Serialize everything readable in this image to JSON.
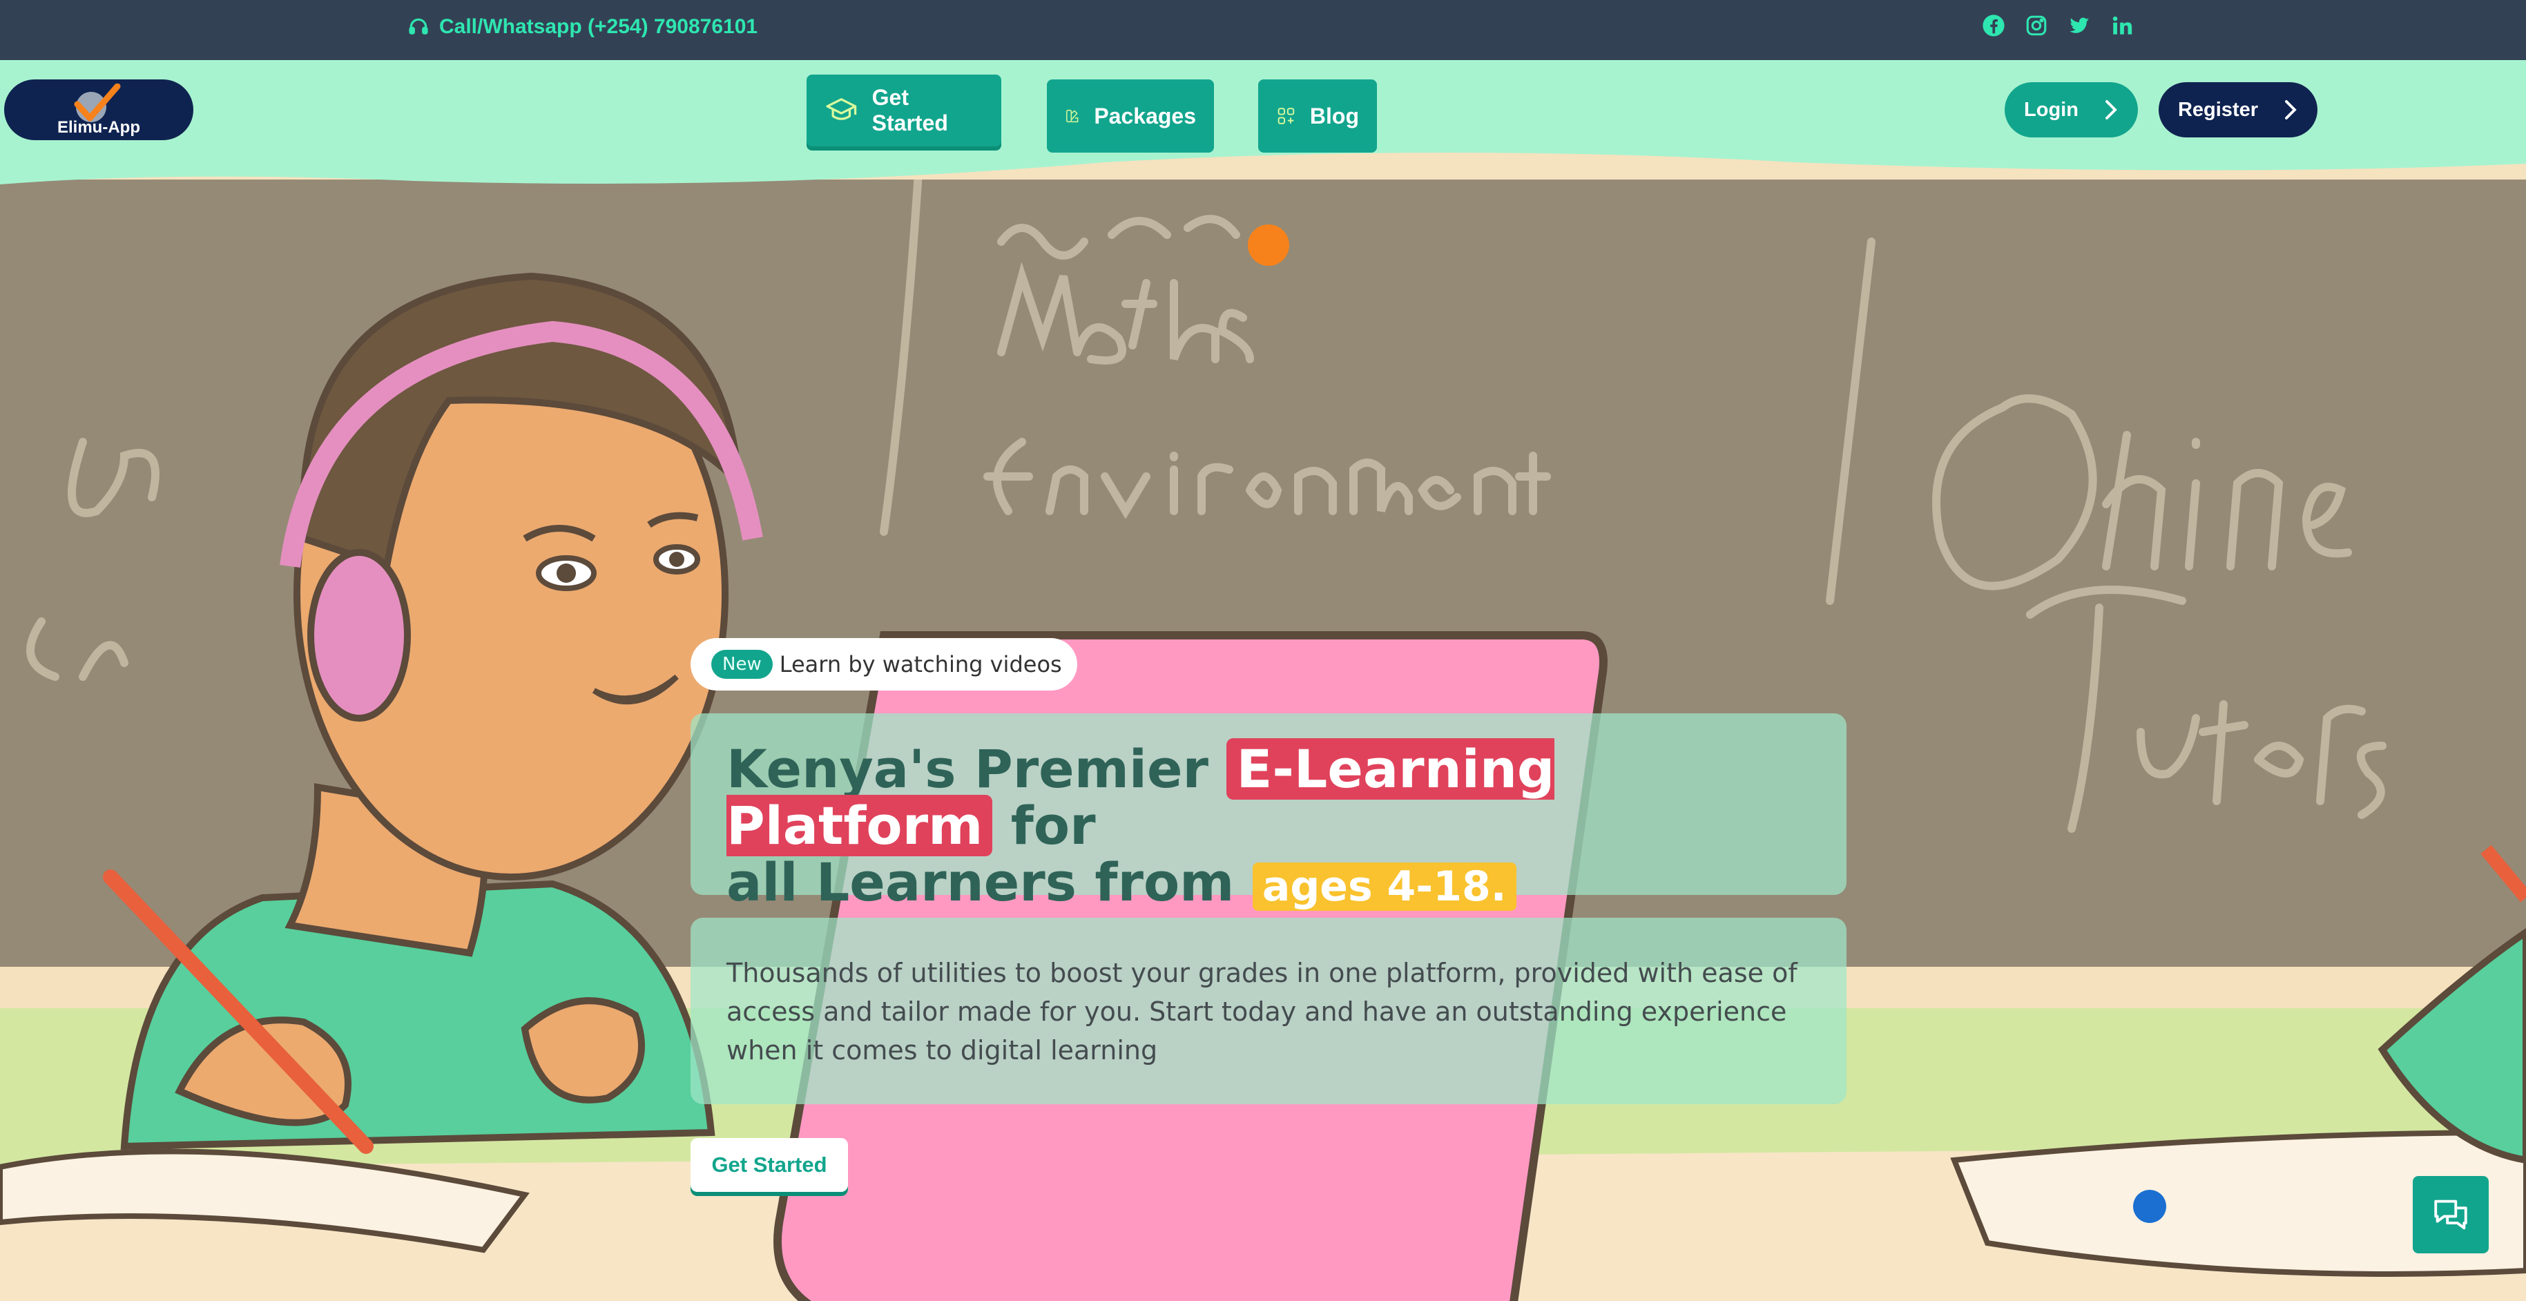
{
  "topbar": {
    "contact_label": "Call/Whatsapp (+254) 790876101",
    "contact_icon": "headset-icon",
    "socials": [
      "facebook-icon",
      "instagram-icon",
      "twitter-icon",
      "linkedin-icon"
    ]
  },
  "navbar": {
    "logo_text": "Elimu-App",
    "items": [
      {
        "label": "Get Started",
        "icon": "graduation-cap-icon"
      },
      {
        "label": "Packages",
        "icon": "palette-icon"
      },
      {
        "label": "Blog",
        "icon": "grid-plus-icon"
      }
    ],
    "login_label": "Login",
    "register_label": "Register"
  },
  "hero": {
    "badge_new": "New",
    "badge_text": "Learn by watching videos",
    "headline_part1": "Kenya's Premier",
    "headline_highlight": "E-Learning Platform",
    "headline_part2": "for",
    "headline_part3": "all Learners from",
    "headline_ages": "ages 4-18.",
    "description": "Thousands of utilities to boost your grades in one platform, provided with ease of access and tailor made for you. Start today and have an outstanding experience when it comes to digital learning",
    "cta_label": "Get Started",
    "board_words": [
      "Maths",
      "Environment",
      "Online",
      "Tutors"
    ]
  },
  "colors": {
    "topbar": "#334155",
    "navbar": "#a7f3d0",
    "accent": "#12a58d",
    "navy": "#0f2350",
    "highlight_red": "#e0425b",
    "highlight_yellow": "#f9c22e"
  },
  "chat": {
    "icon": "chat-icon"
  }
}
